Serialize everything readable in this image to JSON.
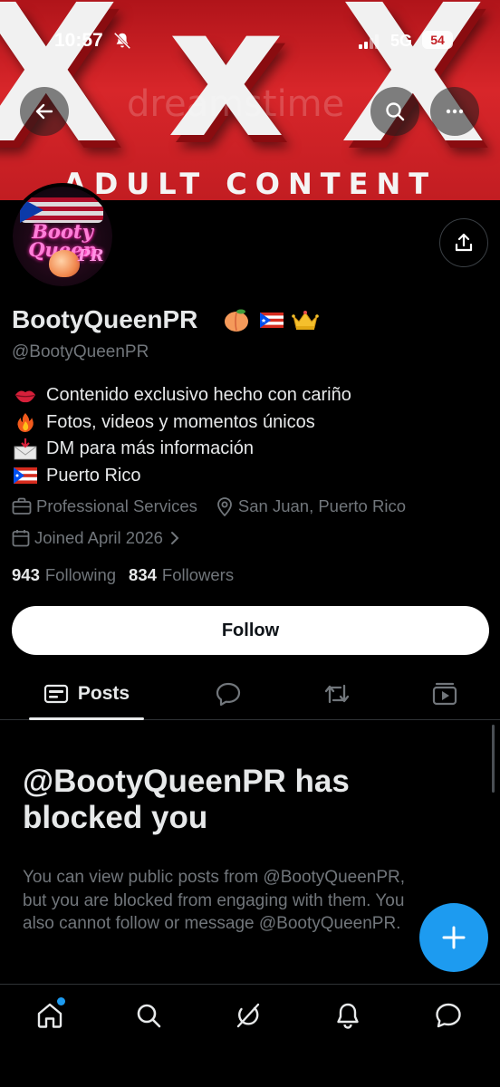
{
  "status_bar": {
    "time": "10:57",
    "network": "5G",
    "battery": "54"
  },
  "banner": {
    "big_letters": [
      "X",
      "x",
      "X"
    ],
    "watermark": "dreamstime",
    "caption": "ADULT CONTENT"
  },
  "avatar": {
    "logo_text": "Booty Queen",
    "logo_sub": "PR"
  },
  "profile": {
    "display_name": "BootyQueenPR",
    "name_emojis": [
      "peach-emoji",
      "puerto-rico-flag-emoji",
      "crown-emoji"
    ],
    "handle": "@BootyQueenPR",
    "bio": [
      {
        "icon": "lips-emoji",
        "text": "Contenido exclusivo hecho con cariño"
      },
      {
        "icon": "fire-emoji",
        "text": "Fotos, videos y momentos únicos"
      },
      {
        "icon": "envelope-arrow-emoji",
        "text": "DM para más información"
      },
      {
        "icon": "puerto-rico-flag-emoji",
        "text": "Puerto Rico"
      }
    ],
    "category": "Professional Services",
    "location": "San Juan, Puerto Rico",
    "joined": "Joined April 2026",
    "following_count": "943",
    "following_label": "Following",
    "followers_count": "834",
    "followers_label": "Followers",
    "follow_button": "Follow"
  },
  "tabs": [
    {
      "label": "Posts",
      "icon": "posts-icon",
      "active": true
    },
    {
      "label": "",
      "icon": "replies-icon",
      "active": false
    },
    {
      "label": "",
      "icon": "reposts-icon",
      "active": false
    },
    {
      "label": "",
      "icon": "media-icon",
      "active": false
    }
  ],
  "blocked": {
    "title_line1": "@BootyQueenPR has",
    "title_line2": "blocked you",
    "desc_line1": "You can view public posts from @BootyQueenPR,",
    "desc_line2": "but you are blocked from engaging with them. You",
    "desc_line3": "also cannot follow or message @BootyQueenPR."
  },
  "bottom_nav": [
    "home-icon",
    "search-icon",
    "grok-icon",
    "notifications-icon",
    "messages-icon"
  ],
  "colors": {
    "accent": "#1d9bf0",
    "background": "#000000",
    "muted": "#71767b",
    "text": "#e7e9ea",
    "banner_red": "#c21d22"
  }
}
